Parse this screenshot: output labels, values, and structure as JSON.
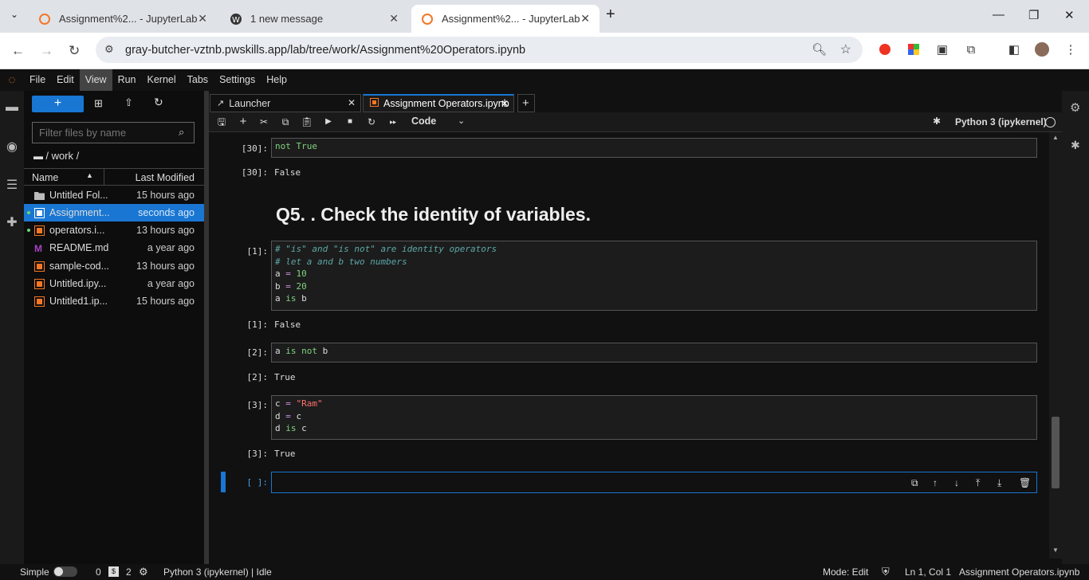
{
  "browser": {
    "tabs": [
      {
        "title": "Assignment%2... - JupyterLab",
        "icon": "jupyter-icon"
      },
      {
        "title": "1 new message",
        "icon": "wordpress-icon"
      },
      {
        "title": "Assignment%2... - JupyterLab",
        "icon": "jupyter-icon",
        "active": true
      }
    ],
    "url": "gray-butcher-vztnb.pwskills.app/lab/tree/work/Assignment%20Operators.ipynb"
  },
  "menu": [
    "File",
    "Edit",
    "View",
    "Run",
    "Kernel",
    "Tabs",
    "Settings",
    "Help"
  ],
  "filebrowser": {
    "filter_placeholder": "Filter files by name",
    "breadcrumb": "/ work /",
    "col_name": "Name",
    "col_modified": "Last Modified",
    "files": [
      {
        "name": "Untitled Fol...",
        "modified": "15 hours ago",
        "icon": "folder-icon"
      },
      {
        "name": "Assignment...",
        "modified": "seconds ago",
        "icon": "notebook-icon",
        "selected": true
      },
      {
        "name": "operators.i...",
        "modified": "13 hours ago",
        "icon": "notebook-icon"
      },
      {
        "name": "README.md",
        "modified": "a year ago",
        "icon": "markdown-icon"
      },
      {
        "name": "sample-cod...",
        "modified": "13 hours ago",
        "icon": "notebook-icon"
      },
      {
        "name": "Untitled.ipy...",
        "modified": "a year ago",
        "icon": "notebook-icon"
      },
      {
        "name": "Untitled1.ip...",
        "modified": "15 hours ago",
        "icon": "notebook-icon"
      }
    ]
  },
  "doctabs": {
    "launcher": "Launcher",
    "notebook": "Assignment Operators.ipynb"
  },
  "toolbar": {
    "cell_type": "Code",
    "kernel": "Python 3 (ipykernel)"
  },
  "cells": {
    "c30_prompt": "[30]:",
    "c30_code": "not True",
    "c30_out_prompt": "[30]:",
    "c30_out": "False",
    "heading": "Q5. . Check the identity of variables.",
    "c1_prompt": "[1]:",
    "c1_line1": "# \"is\" and \"is not\" are identity operators",
    "c1_line2": "# let a and b two numbers",
    "c1_out_prompt": "[1]:",
    "c1_out": "False",
    "c2_prompt": "[2]:",
    "c2_out_prompt": "[2]:",
    "c2_out": "True",
    "c3_prompt": "[3]:",
    "c3_out_prompt": "[3]:",
    "c3_out": "True",
    "empty_prompt": "[ ]:"
  },
  "status": {
    "mode": "Simple",
    "count1": "0",
    "count2": "2",
    "kernel": "Python 3 (ipykernel) | Idle",
    "edit_mode": "Mode: Edit",
    "position": "Ln 1, Col 1",
    "file": "Assignment Operators.ipynb"
  }
}
